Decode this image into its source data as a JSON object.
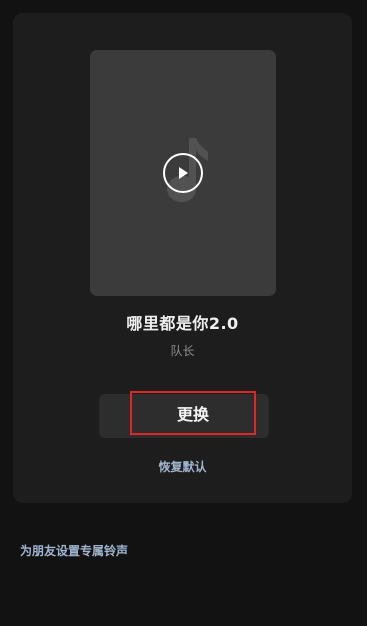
{
  "song": {
    "title": "哪里都是你2.0",
    "artist": "队长"
  },
  "actions": {
    "change_label": "更换",
    "restore_label": "恢复默认"
  },
  "footer": {
    "friend_ringtone_label": "为朋友设置专属铃声"
  },
  "colors": {
    "background": "#121212",
    "card": "#1d1d1d",
    "cover": "#3b3b3b",
    "highlight": "#e02727",
    "link": "#9fb5d0"
  },
  "icons": {
    "cover_icon": "music-note-icon",
    "play_icon": "play-icon"
  }
}
